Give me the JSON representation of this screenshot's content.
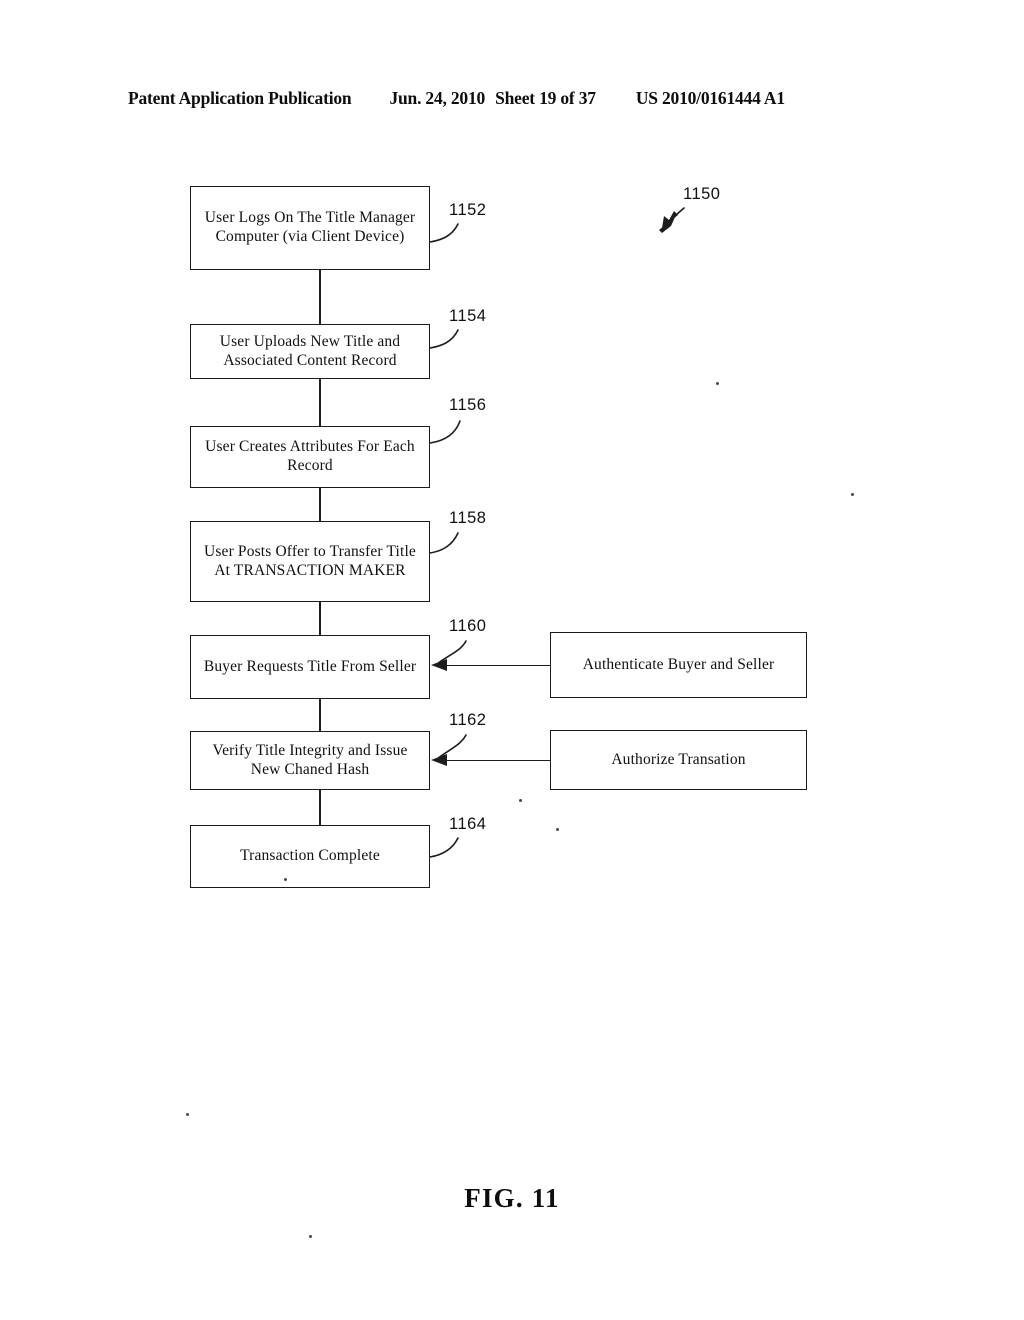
{
  "header": {
    "publication": "Patent Application Publication",
    "date": "Jun. 24, 2010",
    "sheet": "Sheet 19 of 37",
    "patent_number": "US 2010/0161444 A1"
  },
  "figure": {
    "caption": "FIG. 11",
    "diagram_ref": "1150"
  },
  "flow": {
    "steps": [
      {
        "ref": "1152",
        "text": "User Logs On The Title Manager Computer (via Client Device)"
      },
      {
        "ref": "1154",
        "text": "User Uploads New Title and Associated Content Record"
      },
      {
        "ref": "1156",
        "text": "User Creates Attributes For Each Record"
      },
      {
        "ref": "1158",
        "text": "User Posts Offer to Transfer Title At TRANSACTION MAKER"
      },
      {
        "ref": "1160",
        "text": "Buyer Requests Title From Seller"
      },
      {
        "ref": "1162",
        "text": "Verify Title Integrity and Issue New Chaned Hash"
      },
      {
        "ref": "1164",
        "text": "Transaction Complete"
      }
    ],
    "side_steps": [
      {
        "text": "Authenticate Buyer and Seller"
      },
      {
        "text": "Authorize Transation"
      }
    ]
  },
  "colors": {
    "ink": "#121212",
    "paper": "#ffffff"
  }
}
